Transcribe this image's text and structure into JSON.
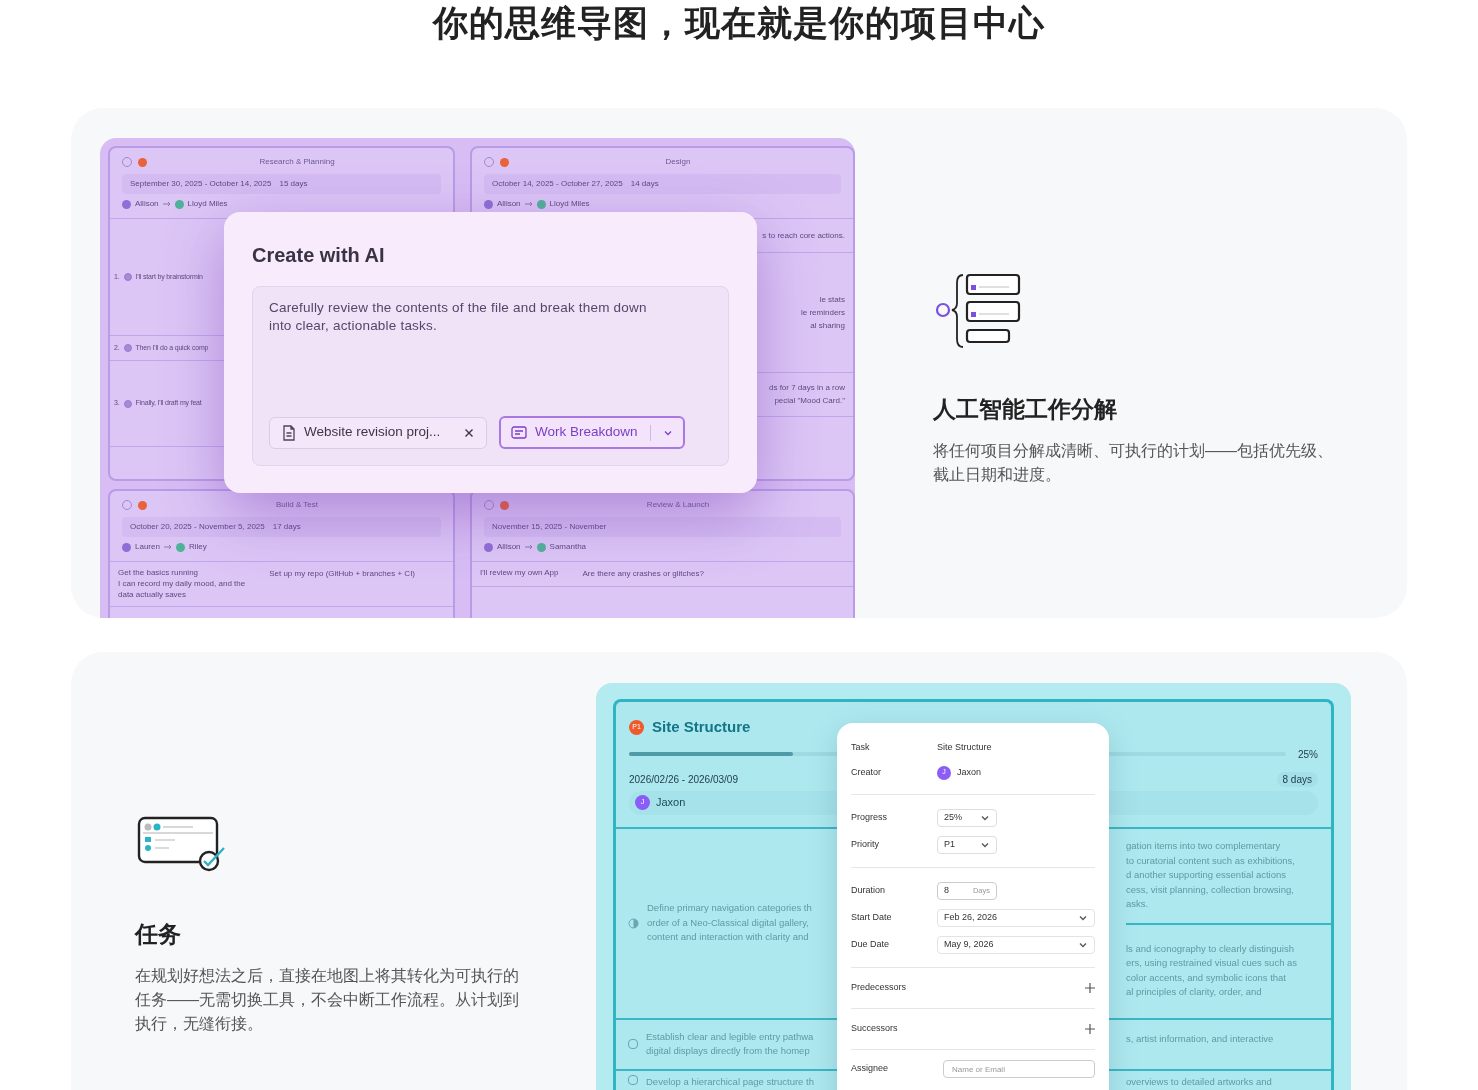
{
  "heading": "你的思维导图，现在就是你的项目中心",
  "ai_section": {
    "mockup": {
      "cards": [
        {
          "title": "Research & Planning",
          "dates": "September 30, 2025 - October 14, 2025",
          "duration": "15 days",
          "from": "Allison",
          "to": "Lloyd Miles",
          "rows": [
            {
              "number": "1.",
              "text": "I'll start by brainstormin",
              "checked": true
            },
            {
              "number": "2.",
              "text": "Then I'll do a quick comp",
              "checked": true
            },
            {
              "number": "3.",
              "text": "Finally, I'll draft my feat",
              "checked": true
            }
          ]
        },
        {
          "title": "Design",
          "dates": "October 14, 2025 - October 27, 2025",
          "duration": "14 days",
          "from": "Allison",
          "to": "Lloyd Miles",
          "rows": [
            {
              "lines": [
                "s to reach core actions."
              ]
            },
            {
              "lines": [
                "le stats",
                "le reminders",
                "al sharing"
              ]
            },
            {
              "lines": [
                "ds for 7 days in a row",
                "pecial \"Mood Card.\""
              ]
            }
          ]
        },
        {
          "title": "Build & Test",
          "dates": "October 20, 2025 - November 5, 2025",
          "duration": "17 days",
          "from": "Lauren",
          "to": "Riley",
          "rows": [
            {
              "lines": [
                "Get the basics running",
                "I can record my daily mood, and the",
                "data actually saves"
              ],
              "side": "Set up my repo (GitHub + branches + CI)"
            }
          ]
        },
        {
          "title": "Review & Launch",
          "dates": "November 15, 2025 - November",
          "from": "Allison",
          "to": "Samantha",
          "rows": [
            {
              "lines": [
                "I'll review my own App"
              ],
              "side": "Are there any crashes or glitches?"
            }
          ]
        }
      ],
      "dialog": {
        "title": "Create with AI",
        "prompt": "Carefully review the contents of the file and break them down into clear, actionable tasks.",
        "attachment": "Website revision proj...",
        "mode": "Work Breakdown"
      }
    },
    "feature": {
      "title": "人工智能工作分解",
      "description": "将任何项目分解成清晰、可执行的计划——包括优先级、截止日期和进度。"
    }
  },
  "tasks_section": {
    "feature": {
      "title": "任务",
      "description": "在规划好想法之后，直接在地图上将其转化为可执行的任务——无需切换工具，不会中断工作流程。从计划到执行，无缝衔接。"
    },
    "mockup": {
      "task": {
        "priority": "P1",
        "title": "Site Structure",
        "level": 0.25,
        "progress": "25%",
        "dates": "2026/02/26 - 2026/03/09",
        "duration": "8 days",
        "assignee": "Jaxon",
        "avatar": "J"
      },
      "subtasks": [
        {
          "kind": "progress",
          "checked": false,
          "left": [
            "Define primary navigation categories th",
            "order of a Neo-Classical digital gallery,",
            "content and interaction with clarity and"
          ],
          "right": [
            [
              "gation items into two complementary",
              "to curatorial content such as exhibitions,",
              "d another supporting essential actions",
              "cess, visit planning, collection browsing,",
              "asks."
            ],
            [
              "ls and iconography to clearly distinguish",
              "ers, using restrained visual cues such as",
              "color accents, and symbolic icons that",
              "al principles of clarity, order, and"
            ]
          ]
        },
        {
          "kind": "checkbox",
          "checked": false,
          "left": [
            "Establish clear and legible entry pathwa",
            "digital displays directly from the homep"
          ],
          "right": [
            [
              "s, artist information, and interactive"
            ]
          ]
        },
        {
          "kind": "checkbox",
          "checked": false,
          "left": [
            "Develop a hierarchical page structure th"
          ],
          "right": [
            [
              "overviews to detailed artworks and"
            ]
          ]
        }
      ],
      "panel": [
        {
          "kind": "text",
          "label": "Task",
          "value": "Site Structure"
        },
        {
          "kind": "person",
          "label": "Creator",
          "value": "Jaxon",
          "avatar": "J"
        },
        {
          "kind": "divider"
        },
        {
          "kind": "select",
          "label": "Progress",
          "value": "25%"
        },
        {
          "kind": "select",
          "label": "Priority",
          "value": "P1"
        },
        {
          "kind": "divider"
        },
        {
          "kind": "number",
          "label": "Duration",
          "value": "8",
          "unit": "Days"
        },
        {
          "kind": "date",
          "label": "Start Date",
          "value": "Feb 26, 2026"
        },
        {
          "kind": "date",
          "label": "Due Date",
          "value": "May 9, 2026"
        },
        {
          "kind": "divider"
        },
        {
          "kind": "add",
          "label": "Predecessors"
        },
        {
          "kind": "divider"
        },
        {
          "kind": "add",
          "label": "Successors"
        },
        {
          "kind": "divider"
        },
        {
          "kind": "input",
          "label": "Assignee",
          "placeholder": "Name or Email"
        }
      ]
    }
  }
}
